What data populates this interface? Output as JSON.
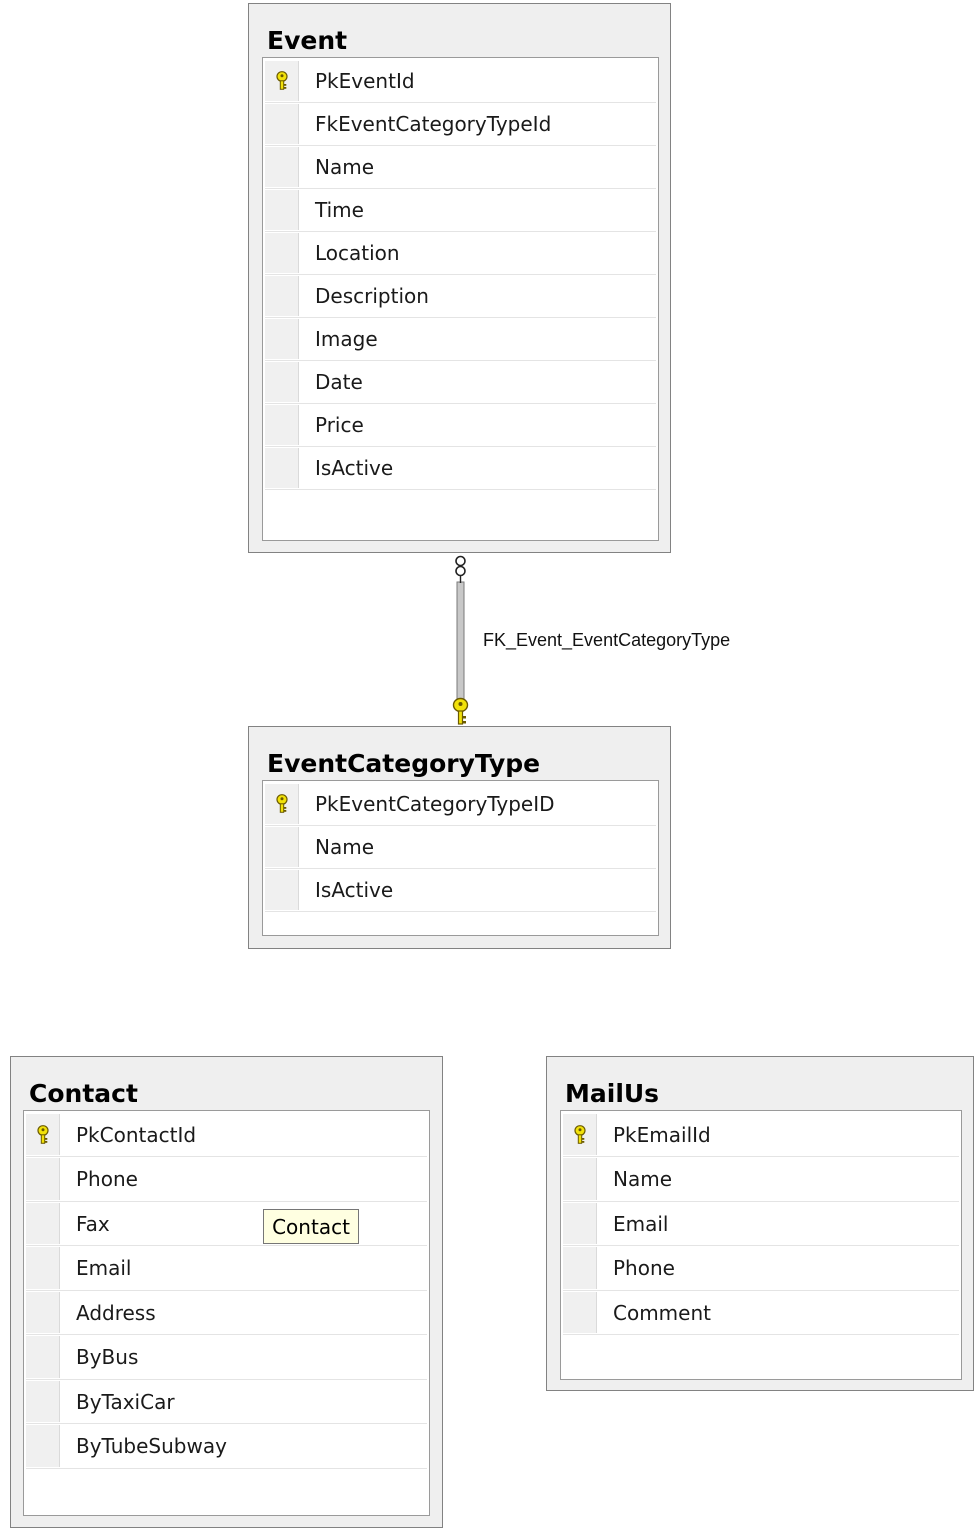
{
  "tables": [
    {
      "name": "Event",
      "columns": [
        {
          "name": "PkEventId",
          "primary_key": true
        },
        {
          "name": "FkEventCategoryTypeId",
          "primary_key": false
        },
        {
          "name": "Name",
          "primary_key": false
        },
        {
          "name": "Time",
          "primary_key": false
        },
        {
          "name": "Location",
          "primary_key": false
        },
        {
          "name": "Description",
          "primary_key": false
        },
        {
          "name": "Image",
          "primary_key": false
        },
        {
          "name": "Date",
          "primary_key": false
        },
        {
          "name": "Price",
          "primary_key": false
        },
        {
          "name": "IsActive",
          "primary_key": false
        }
      ]
    },
    {
      "name": "EventCategoryType",
      "columns": [
        {
          "name": "PkEventCategoryTypeID",
          "primary_key": true
        },
        {
          "name": "Name",
          "primary_key": false
        },
        {
          "name": "IsActive",
          "primary_key": false
        }
      ]
    },
    {
      "name": "Contact",
      "columns": [
        {
          "name": "PkContactId",
          "primary_key": true
        },
        {
          "name": "Phone",
          "primary_key": false
        },
        {
          "name": "Fax",
          "primary_key": false
        },
        {
          "name": "Email",
          "primary_key": false
        },
        {
          "name": "Address",
          "primary_key": false
        },
        {
          "name": "ByBus",
          "primary_key": false
        },
        {
          "name": "ByTaxiCar",
          "primary_key": false
        },
        {
          "name": "ByTubeSubway",
          "primary_key": false
        }
      ]
    },
    {
      "name": "MailUs",
      "columns": [
        {
          "name": "PkEmailId",
          "primary_key": true
        },
        {
          "name": "Name",
          "primary_key": false
        },
        {
          "name": "Email",
          "primary_key": false
        },
        {
          "name": "Phone",
          "primary_key": false
        },
        {
          "name": "Comment",
          "primary_key": false
        }
      ]
    }
  ],
  "relationship": {
    "label": "FK_Event_EventCategoryType",
    "from_table": "Event",
    "to_table": "EventCategoryType",
    "from_end": "many-infinity-icon",
    "to_end": "primary-key-icon"
  },
  "tooltip": {
    "text": "Contact"
  },
  "colors": {
    "key_fill": "#f2e20a",
    "key_stroke": "#6b5a00",
    "relationship_line": "#9e9e9e"
  }
}
